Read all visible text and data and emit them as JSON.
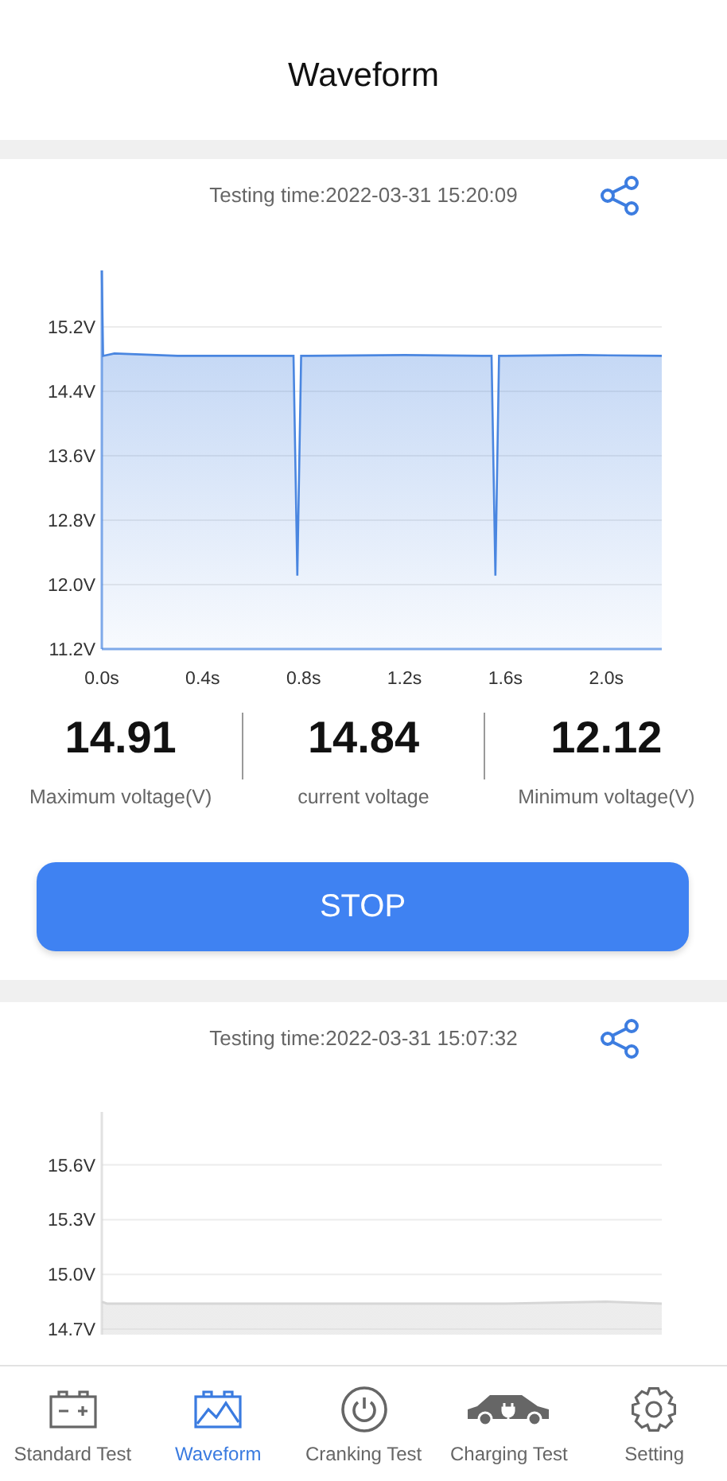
{
  "header": {
    "title": "Waveform"
  },
  "records": [
    {
      "testing_time": "Testing time:2022-03-31 15:20:09",
      "chart_data": {
        "type": "area",
        "xlim": [
          0,
          2.22
        ],
        "ylim": [
          11.2,
          15.9
        ],
        "xticks": [
          {
            "value": 0,
            "label": "0.0s"
          },
          {
            "value": 0.4,
            "label": "0.4s"
          },
          {
            "value": 0.8,
            "label": "0.8s"
          },
          {
            "value": 1.2,
            "label": "1.2s"
          },
          {
            "value": 1.6,
            "label": "1.6s"
          },
          {
            "value": 2.0,
            "label": "2.0s"
          }
        ],
        "yticks": [
          {
            "value": 11.2,
            "label": "11.2V"
          },
          {
            "value": 12.0,
            "label": "12.0V"
          },
          {
            "value": 12.8,
            "label": "12.8V"
          },
          {
            "value": 13.6,
            "label": "13.6V"
          },
          {
            "value": 14.4,
            "label": "14.4V"
          },
          {
            "value": 15.2,
            "label": "15.2V"
          }
        ],
        "x": [
          0,
          0.005,
          0.05,
          0.3,
          0.73,
          0.76,
          0.775,
          0.79,
          0.82,
          1.2,
          1.51,
          1.545,
          1.56,
          1.575,
          1.6,
          1.9,
          2.22
        ],
        "grid": true,
        "series": [
          {
            "color": "#4a86e0",
            "values": [
              15.9,
              14.84,
              14.87,
              14.84,
              14.84,
              14.84,
              12.11,
              14.84,
              14.84,
              14.85,
              14.84,
              14.84,
              12.11,
              14.84,
              14.84,
              14.85,
              14.84
            ]
          }
        ]
      },
      "stats": [
        {
          "value": "14.91",
          "label": "Maximum voltage(V)"
        },
        {
          "value": "14.84",
          "label": "current voltage"
        },
        {
          "value": "12.12",
          "label": "Minimum voltage(V)"
        }
      ],
      "button": "STOP"
    },
    {
      "testing_time": "Testing time:2022-03-31 15:07:32",
      "chart_data": {
        "type": "area",
        "xlim": [
          0,
          2.22
        ],
        "ylim": [
          14.67,
          15.89
        ],
        "yticks": [
          {
            "value": 14.7,
            "label": "14.7V"
          },
          {
            "value": 15.0,
            "label": "15.0V"
          },
          {
            "value": 15.3,
            "label": "15.3V"
          },
          {
            "value": 15.6,
            "label": "15.6V"
          }
        ],
        "x": [
          0,
          0.02,
          0.4,
          0.8,
          1.2,
          1.6,
          2.0,
          2.22
        ],
        "grid": true,
        "series": [
          {
            "color": "#d6d6d6",
            "values": [
              14.85,
              14.84,
              14.84,
              14.84,
              14.84,
              14.84,
              14.85,
              14.84
            ]
          }
        ]
      }
    }
  ],
  "nav": [
    {
      "label": "Standard Test",
      "selected": false
    },
    {
      "label": "Waveform",
      "selected": true
    },
    {
      "label": "Cranking Test",
      "selected": false
    },
    {
      "label": "Charging Test",
      "selected": false
    },
    {
      "label": "Setting",
      "selected": false
    }
  ]
}
